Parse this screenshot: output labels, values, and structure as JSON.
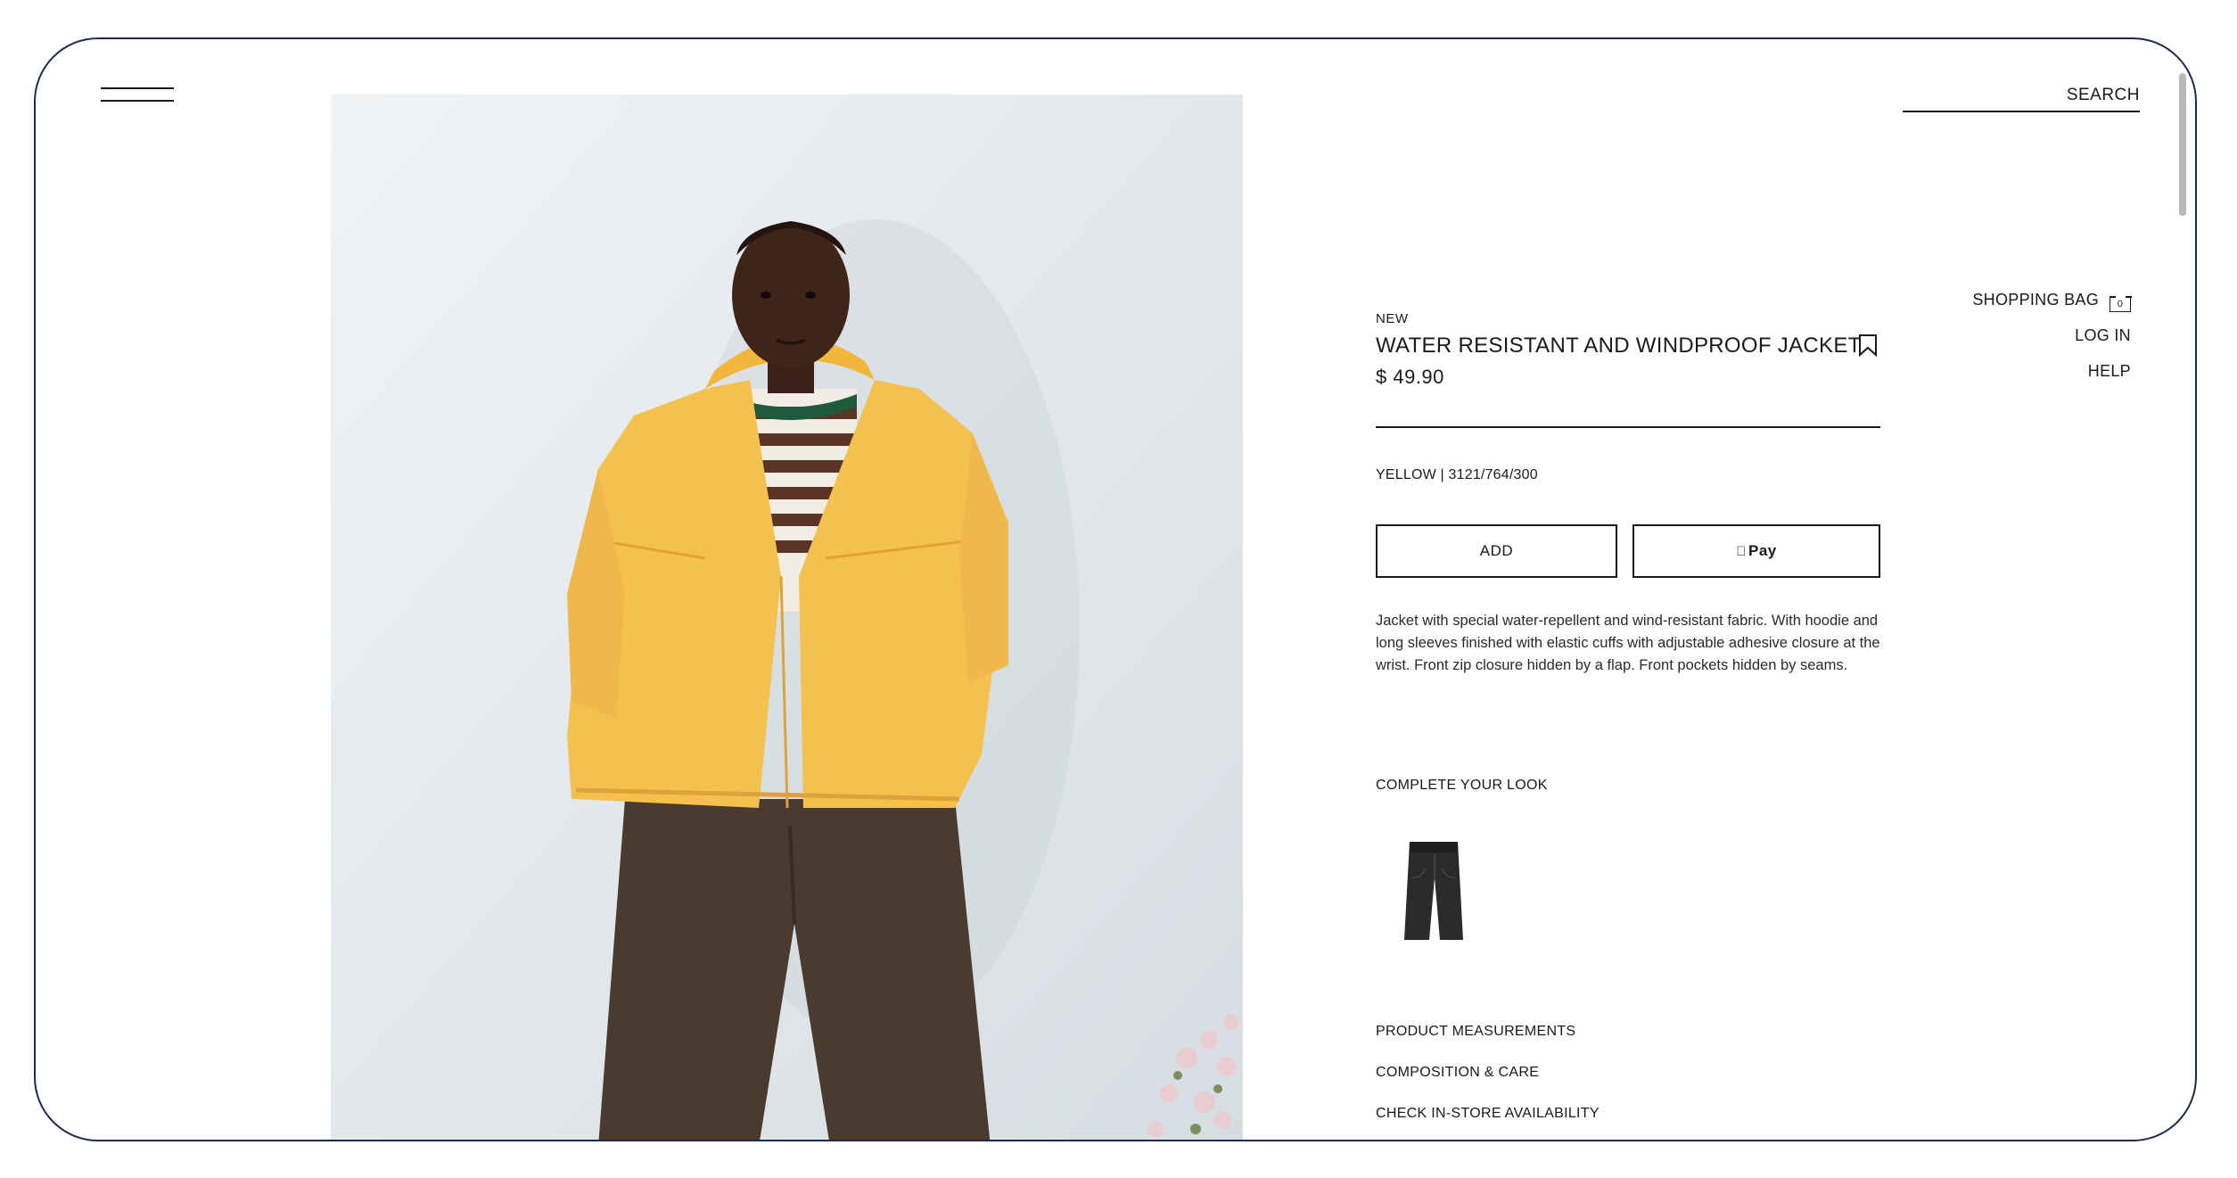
{
  "header": {
    "menu_icon": "hamburger-menu-icon",
    "search_label": "SEARCH"
  },
  "nav": {
    "shopping_bag_label": "SHOPPING BAG",
    "bag_count": "0",
    "login_label": "LOG IN",
    "help_label": "HELP"
  },
  "product": {
    "tag": "NEW",
    "name": "WATER RESISTANT AND WINDPROOF JACKET",
    "price": "$ 49.90",
    "color_ref": "YELLOW | 3121/764/300",
    "add_label": "ADD",
    "pay_label": "Pay",
    "description": "Jacket with special water-repellent and wind-resistant fabric. With hoodie and long sleeves finished with elastic cuffs with adjustable adhesive closure at the wrist. Front zip closure hidden by a flap. Front pockets hidden by seams.",
    "bookmark_icon": "bookmark-icon"
  },
  "complete_look": {
    "title": "COMPLETE YOUR LOOK",
    "items": [
      {
        "icon": "jeans-thumbnail"
      }
    ]
  },
  "accordions": [
    {
      "label": "PRODUCT MEASUREMENTS"
    },
    {
      "label": "COMPOSITION & CARE"
    },
    {
      "label": "CHECK IN-STORE AVAILABILITY"
    }
  ],
  "colors": {
    "jacket": "#f5c14e",
    "background": "#e6ebee",
    "frame_border": "#1d2b49"
  }
}
